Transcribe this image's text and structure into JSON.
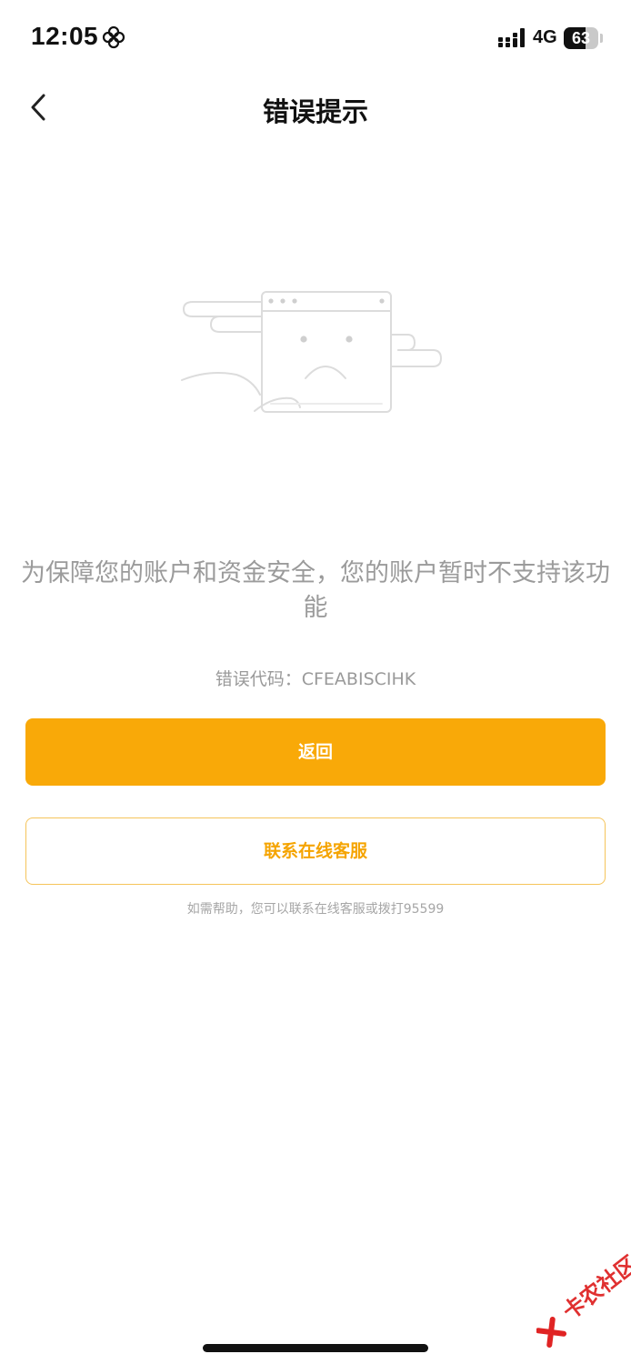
{
  "status_bar": {
    "time": "12:05",
    "network": "4G",
    "battery_level": 63,
    "battery_text": "63"
  },
  "nav": {
    "title": "错误提示"
  },
  "main": {
    "message": "为保障您的账户和资金安全，您的账户暂时不支持该功能",
    "error_code": "错误代码：CFEABISCIHK",
    "primary_button_label": "返回",
    "secondary_button_label": "联系在线客服",
    "help_text": "如需帮助，您可以联系在线客服或拨打95599"
  },
  "watermark": {
    "text": "卡农社区"
  },
  "colors": {
    "accent": "#f9a908",
    "accent_text": "#f5a400",
    "secondary_border": "#f5c45a",
    "muted_text": "#9b9b9b"
  }
}
